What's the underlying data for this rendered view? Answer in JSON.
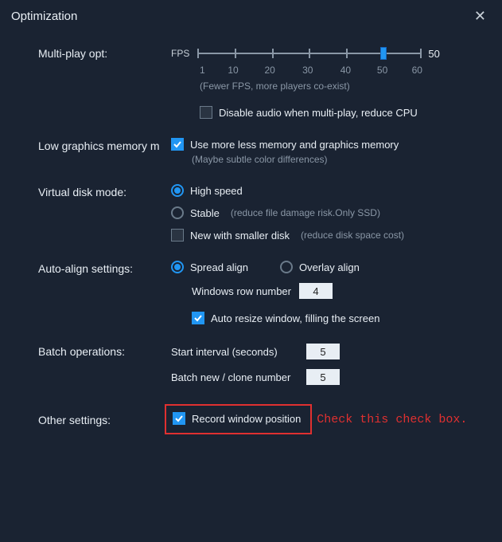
{
  "title": "Optimization",
  "sections": {
    "multi_play": {
      "label": "Multi-play opt:",
      "fps_label": "FPS",
      "fps_end": "50",
      "ticks": [
        "1",
        "10",
        "20",
        "30",
        "40",
        "50",
        "60"
      ],
      "slider_value_index": 5,
      "hint": "(Fewer FPS, more players co-exist)",
      "disable_audio": {
        "checked": false,
        "label": "Disable audio when multi-play, reduce CPU"
      }
    },
    "low_gfx": {
      "label": "Low graphics memory m",
      "use_less": {
        "checked": true,
        "label": "Use more less memory and graphics memory",
        "sub": "(Maybe subtle color differences)"
      }
    },
    "vdisk": {
      "label": "Virtual disk mode:",
      "high_speed": {
        "selected": true,
        "label": "High speed"
      },
      "stable": {
        "selected": false,
        "label": "Stable",
        "hint": "(reduce file damage risk.Only SSD)"
      },
      "new_smaller": {
        "checked": false,
        "label": "New with smaller disk",
        "hint": "(reduce disk space cost)"
      }
    },
    "align": {
      "label": "Auto-align settings:",
      "spread": {
        "selected": true,
        "label": "Spread align"
      },
      "overlay": {
        "selected": false,
        "label": "Overlay align"
      },
      "row_number_label": "Windows row number",
      "row_number": "4",
      "auto_resize": {
        "checked": true,
        "label": "Auto resize window, filling the screen"
      }
    },
    "batch": {
      "label": "Batch operations:",
      "start_interval_label": "Start interval (seconds)",
      "start_interval": "5",
      "clone_label": "Batch new / clone number",
      "clone": "5"
    },
    "other": {
      "label": "Other settings:",
      "record": {
        "checked": true,
        "label": "Record window position"
      }
    }
  },
  "annotation": "Check this check box."
}
